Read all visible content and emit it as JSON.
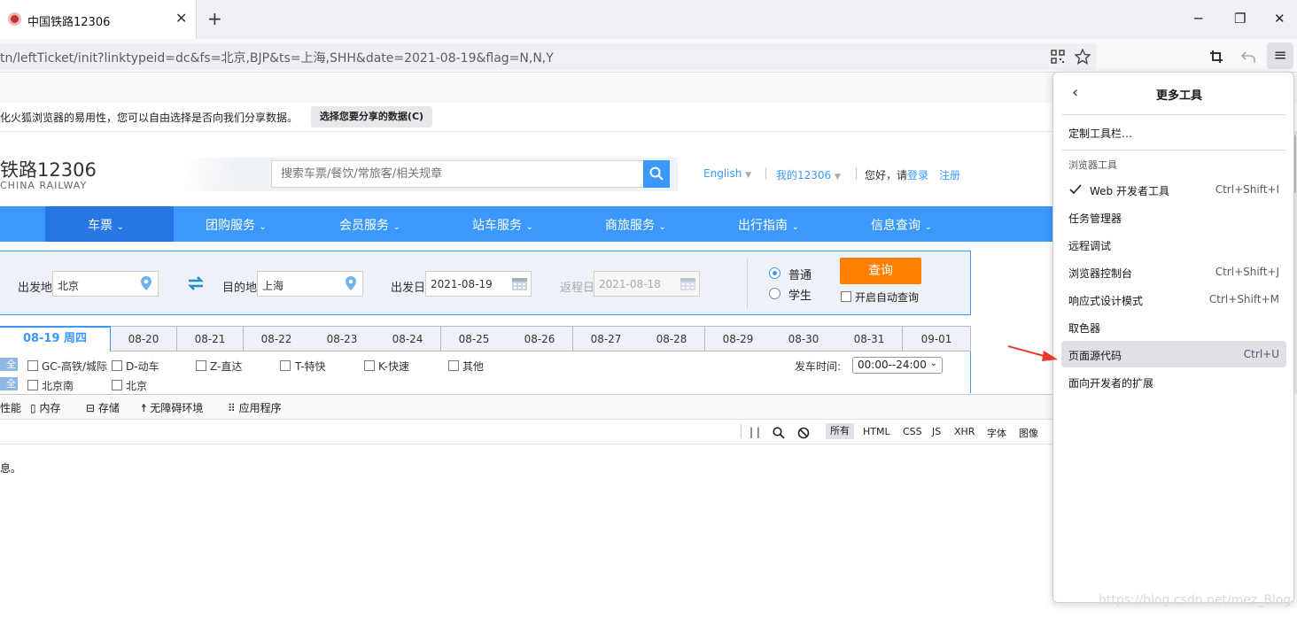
{
  "browser": {
    "tab_title": "中国铁路12306",
    "tab_close": "✕",
    "new_tab": "+",
    "url": "tn/leftTicket/init?linktypeid=dc&fs=北京,BJP&ts=上海,SHH&date=2021-08-19&flag=N,N,Y",
    "win_min": "─",
    "win_max": "❐",
    "win_close": "✕",
    "menu_icon": "≡"
  },
  "notification": {
    "text": "化火狐浏览器的易用性，您可以自由选择是否向我们分享数据。",
    "button": "选择您要分享的数据(C)"
  },
  "site": {
    "logo_cn": "铁路12306",
    "logo_en": "CHINA RAILWAY",
    "search_placeholder": "搜索车票/餐饮/常旅客/相关规章",
    "english": "English",
    "my12306": "我的12306",
    "hello": "您好，请",
    "login": "登录",
    "register": "注册",
    "nav": [
      "车票",
      "团购服务",
      "会员服务",
      "站车服务",
      "商旅服务",
      "出行指南",
      "信息查询"
    ]
  },
  "query": {
    "from_label": "出发地",
    "from_value": "北京",
    "to_label": "目的地",
    "to_value": "上海",
    "date_label": "出发日",
    "date_value": "2021-08-19",
    "return_label": "返程日",
    "return_value": "2021-08-18",
    "radio_normal": "普通",
    "radio_student": "学生",
    "query_button": "查询",
    "auto_query": "开启自动查询"
  },
  "dates": {
    "active": "08-19 周四",
    "items": [
      "08-20",
      "08-21",
      "08-22",
      "08-23",
      "08-24",
      "08-25",
      "08-26",
      "08-27",
      "08-28",
      "08-29",
      "08-30",
      "08-31",
      "09-01"
    ]
  },
  "filters": {
    "all": "全部",
    "types": [
      "GC-高铁/城际",
      "D-动车",
      "Z-直达",
      "T-特快",
      "K-快速",
      "其他"
    ],
    "stations": [
      "北京南",
      "北京"
    ],
    "time_label": "发车时间:",
    "time_value": "00:00--24:00"
  },
  "devtools": {
    "tabs": [
      "性能",
      "内存",
      "存储",
      "无障碍环境",
      "应用程序"
    ],
    "filters": [
      "所有",
      "HTML",
      "CSS",
      "JS",
      "XHR",
      "字体",
      "图像"
    ],
    "console_text": "息。"
  },
  "panel": {
    "title": "更多工具",
    "customize": "定制工具栏…",
    "section": "浏览器工具",
    "items": [
      {
        "label": "Web 开发者工具",
        "key": "Ctrl+Shift+I"
      },
      {
        "label": "任务管理器",
        "key": ""
      },
      {
        "label": "远程调试",
        "key": ""
      },
      {
        "label": "浏览器控制台",
        "key": "Ctrl+Shift+J"
      },
      {
        "label": "响应式设计模式",
        "key": "Ctrl+Shift+M"
      },
      {
        "label": "取色器",
        "key": ""
      },
      {
        "label": "页面源代码",
        "key": "Ctrl+U"
      },
      {
        "label": "面向开发者的扩展",
        "key": ""
      }
    ]
  },
  "watermark": "https://blog.csdn.net/mez_Blog",
  "colors": {
    "accent": "#3b99fc",
    "nav_active": "#2676e3",
    "query_button": "#ff8000",
    "arrow": "#e8392f"
  }
}
